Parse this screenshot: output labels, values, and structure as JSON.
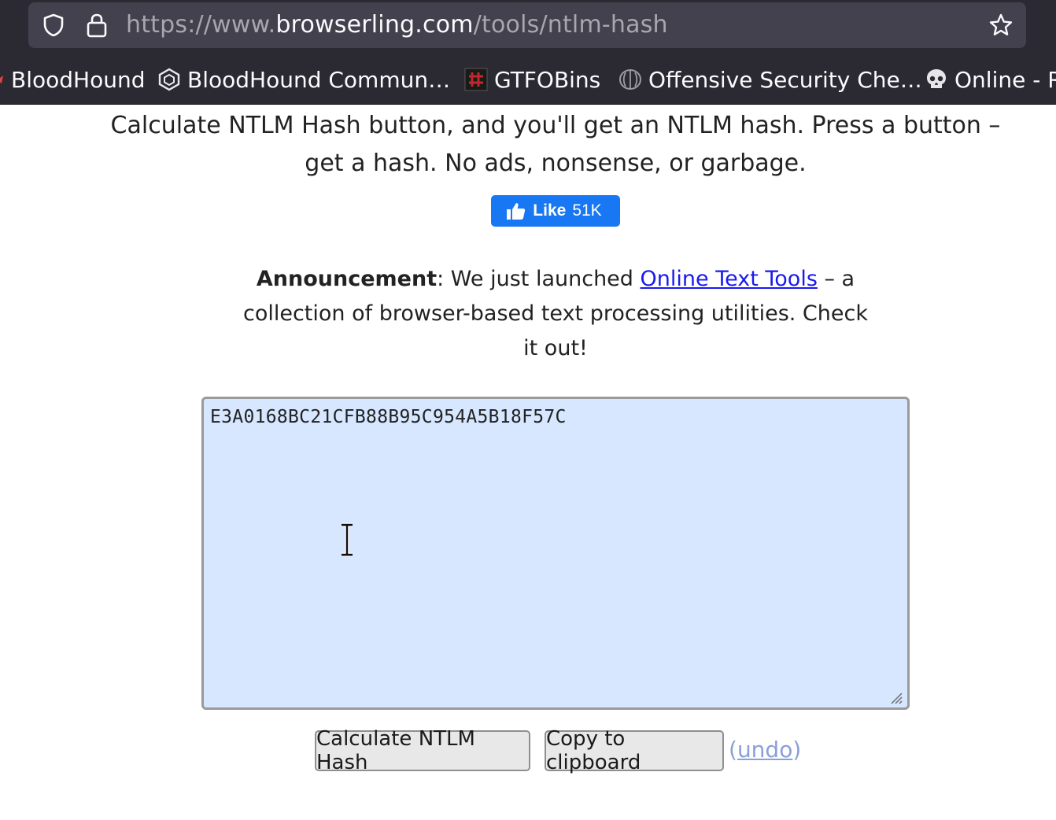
{
  "browser": {
    "url_scheme_prefix": "https://www.",
    "url_host": "browserling.com",
    "url_path": "/tools/ntlm-hash",
    "bookmarks": [
      {
        "label": "BloodHound",
        "icon": "bloodhound-icon"
      },
      {
        "label": "BloodHound Commun…",
        "icon": "hexagon-icon"
      },
      {
        "label": "GTFOBins",
        "icon": "gtfobins-icon"
      },
      {
        "label": "Offensive Security Che…",
        "icon": "brain-icon"
      },
      {
        "label": "Online - R",
        "icon": "skull-icon"
      }
    ]
  },
  "page": {
    "intro_line1": "Calculate NTLM Hash button, and you'll get an NTLM hash. Press a button –",
    "intro_line2": "get a hash. No ads, nonsense, or garbage.",
    "like_label": "Like",
    "like_count": "51K",
    "announcement": {
      "label": "Announcement",
      "text_before": ": We just launched ",
      "link_text": "Online Text Tools",
      "text_after": " – a collection of browser-based text processing utilities. Check it out!"
    },
    "output_value": "E3A0168BC21CFB88B95C954A5B18F57C",
    "calculate_button": "Calculate NTLM Hash",
    "copy_button": "Copy to clipboard",
    "undo_open": "(",
    "undo_link": "undo",
    "undo_close": ")"
  },
  "colors": {
    "chrome_bg": "#2b2a33",
    "urlbar_bg": "#42414d",
    "facebook_blue": "#1877f2",
    "textarea_bg": "#d6e7ff",
    "link": "#1a1aee",
    "undo_link": "#8aa0d8"
  }
}
